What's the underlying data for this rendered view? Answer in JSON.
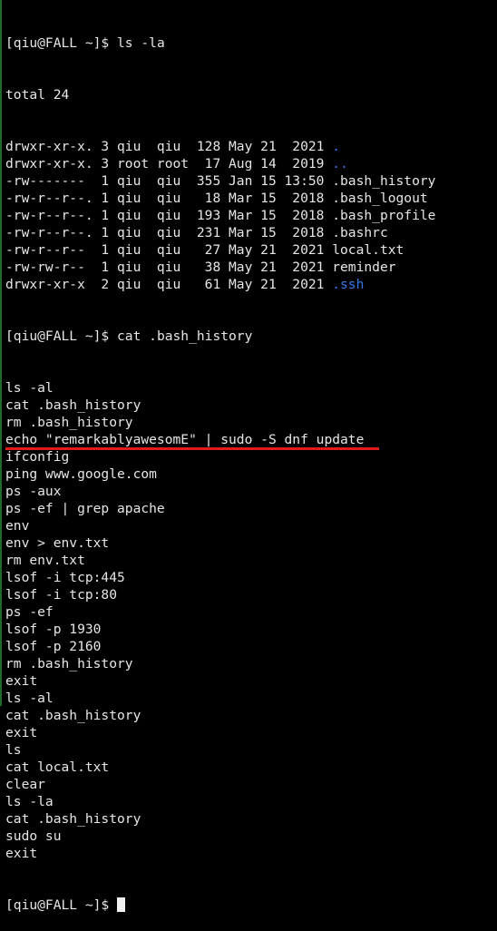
{
  "prompt": "[qiu@FALL ~]$ ",
  "session": {
    "cmd1": "ls -la",
    "listing": {
      "total": "total 24",
      "rows": [
        {
          "meta": "drwxr-xr-x. 3 qiu  qiu  128 May 21  2021 ",
          "name": ".",
          "is_dir": true
        },
        {
          "meta": "drwxr-xr-x. 3 root root  17 Aug 14  2019 ",
          "name": "..",
          "is_dir": true
        },
        {
          "meta": "-rw-------  1 qiu  qiu  355 Jan 15 13:50 ",
          "name": ".bash_history",
          "is_dir": false
        },
        {
          "meta": "-rw-r--r--. 1 qiu  qiu   18 Mar 15  2018 ",
          "name": ".bash_logout",
          "is_dir": false
        },
        {
          "meta": "-rw-r--r--. 1 qiu  qiu  193 Mar 15  2018 ",
          "name": ".bash_profile",
          "is_dir": false
        },
        {
          "meta": "-rw-r--r--. 1 qiu  qiu  231 Mar 15  2018 ",
          "name": ".bashrc",
          "is_dir": false
        },
        {
          "meta": "-rw-r--r--  1 qiu  qiu   27 May 21  2021 ",
          "name": "local.txt",
          "is_dir": false
        },
        {
          "meta": "-rw-rw-r--  1 qiu  qiu   38 May 21  2021 ",
          "name": "reminder",
          "is_dir": false
        },
        {
          "meta": "drwxr-xr-x  2 qiu  qiu   61 May 21  2021 ",
          "name": ".ssh",
          "is_dir": true
        }
      ]
    },
    "cmd2": "cat .bash_history",
    "history": [
      "ls -al",
      "cat .bash_history",
      "rm .bash_history",
      "echo \"remarkablyawesomE\" | sudo -S dnf update",
      "ifconfig",
      "ping www.google.com",
      "ps -aux",
      "ps -ef | grep apache",
      "env",
      "env > env.txt",
      "rm env.txt",
      "lsof -i tcp:445",
      "lsof -i tcp:80",
      "ps -ef",
      "lsof -p 1930",
      "lsof -p 2160",
      "rm .bash_history",
      "exit",
      "ls -al",
      "cat .bash_history",
      "exit",
      "ls",
      "cat local.txt",
      "clear",
      "ls -la",
      "cat .bash_history",
      "sudo su",
      "exit"
    ],
    "highlighted_index": 3
  },
  "colors": {
    "background": "#000000",
    "text": "#e6e6e6",
    "directory": "#2f7be8",
    "underline": "#e01b1b"
  }
}
